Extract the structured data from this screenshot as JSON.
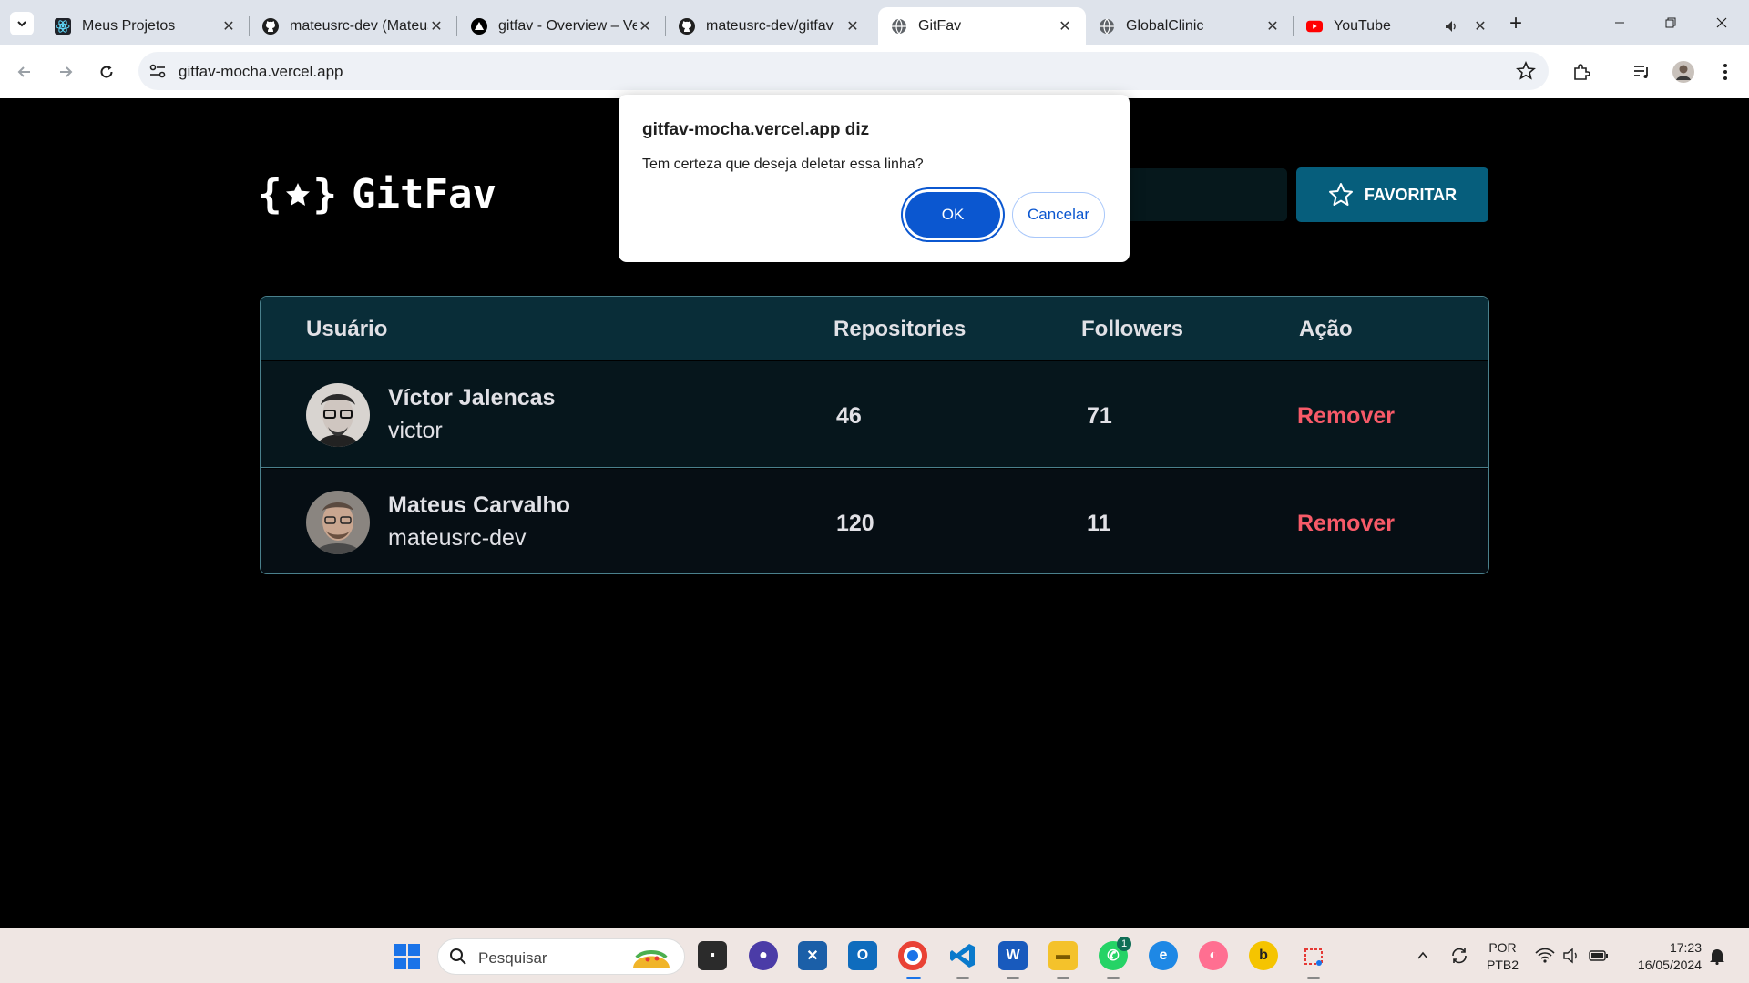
{
  "browser": {
    "tabs": [
      {
        "title": "Meus Projetos",
        "favicon": "react-icon"
      },
      {
        "title": "mateusrc-dev (Mateus Carvalho)",
        "favicon": "github-icon"
      },
      {
        "title": "gitfav - Overview – Vercel",
        "favicon": "vercel-icon"
      },
      {
        "title": "mateusrc-dev/gitfav",
        "favicon": "github-icon"
      },
      {
        "title": "GitFav",
        "favicon": "globe-icon"
      },
      {
        "title": "GlobalClinic",
        "favicon": "globe-icon"
      },
      {
        "title": "YouTube",
        "favicon": "youtube-icon"
      }
    ],
    "active_tab_index": 4,
    "url": "gitfav-mocha.vercel.app"
  },
  "app": {
    "brand": "GitFav",
    "brace_open": "{",
    "brace_close": "}",
    "favorite_button": "FAVORITAR"
  },
  "table": {
    "headers": [
      "Usuário",
      "Repositories",
      "Followers",
      "Ação"
    ],
    "rows": [
      {
        "name": "Víctor Jalencas",
        "login": "victor",
        "repositories": "46",
        "followers": "71",
        "action": "Remover"
      },
      {
        "name": "Mateus Carvalho",
        "login": "mateusrc-dev",
        "repositories": "120",
        "followers": "11",
        "action": "Remover"
      }
    ]
  },
  "dialog": {
    "title": "gitfav-mocha.vercel.app diz",
    "message": "Tem certeza que deseja deletar essa linha?",
    "ok": "OK",
    "cancel": "Cancelar"
  },
  "taskbar": {
    "search_placeholder": "Pesquisar",
    "whatsapp_badge": "1",
    "language": "POR",
    "layout": "PTB2",
    "time": "17:23",
    "date": "16/05/2024"
  },
  "colors": {
    "accent": "#065e7c",
    "remove": "#f75a68",
    "dialog_ok": "#0b57d0"
  }
}
